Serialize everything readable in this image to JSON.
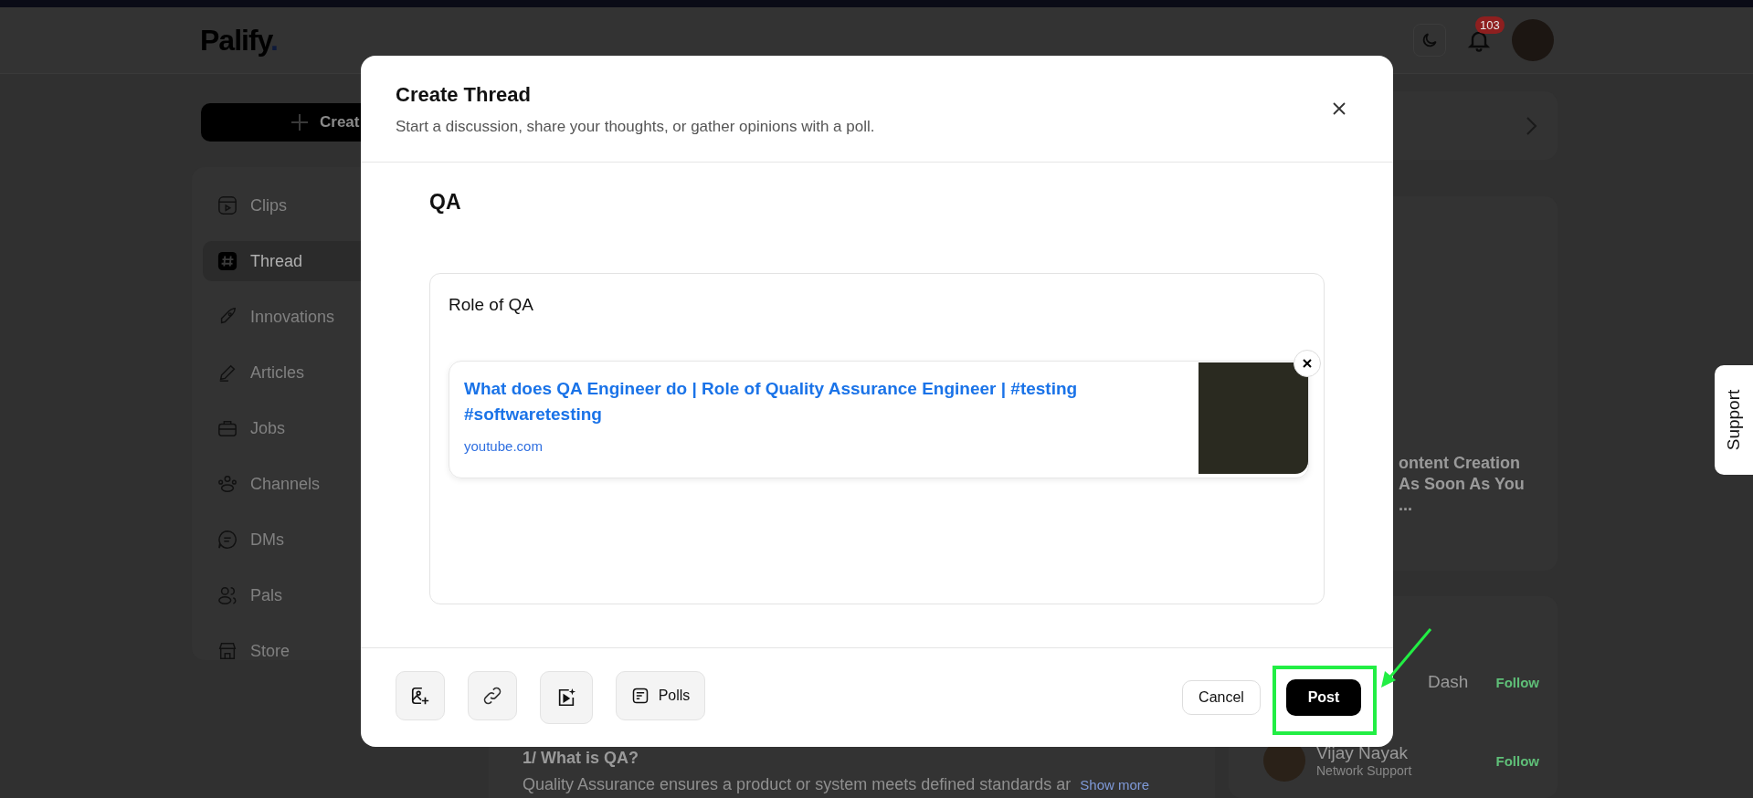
{
  "header": {
    "logo": "Palify",
    "logo_dot": ".",
    "notification_count": "103"
  },
  "sidebar": {
    "create_button": "Creat",
    "items": [
      {
        "label": "Clips",
        "selected": false
      },
      {
        "label": "Thread",
        "selected": true
      },
      {
        "label": "Innovations",
        "selected": false
      },
      {
        "label": "Articles",
        "selected": false
      },
      {
        "label": "Jobs",
        "selected": false
      },
      {
        "label": "Channels",
        "selected": false
      },
      {
        "label": "DMs",
        "selected": false
      },
      {
        "label": "Pals",
        "selected": false
      },
      {
        "label": "Store",
        "selected": false
      }
    ]
  },
  "feed": {
    "post_heading": "1/ What is QA?",
    "post_text": "Quality Assurance ensures a product or system meets defined standards ar",
    "show_more": "Show more"
  },
  "right_panel": {
    "trending_lines": [
      "ontent Creation",
      "As Soon As You",
      "..."
    ],
    "suggestions": [
      {
        "name": "Dash",
        "follow": "Follow"
      },
      {
        "name": "Vijay Nayak",
        "role": "Network Support",
        "follow": "Follow"
      }
    ]
  },
  "support_tab": "Support",
  "modal": {
    "title": "Create Thread",
    "subtitle": "Start a discussion, share your thoughts, or gather opinions with a poll.",
    "thread_title": "QA",
    "body": "Role of QA",
    "link_preview": {
      "title": "What does QA Engineer do | Role of Quality Assurance Engineer | #testing #softwaretesting",
      "domain": "youtube.com"
    },
    "tools": [
      {
        "kind": "image"
      },
      {
        "kind": "link"
      },
      {
        "kind": "video"
      },
      {
        "kind": "polls",
        "label": "Polls"
      }
    ],
    "cancel": "Cancel",
    "post": "Post"
  }
}
